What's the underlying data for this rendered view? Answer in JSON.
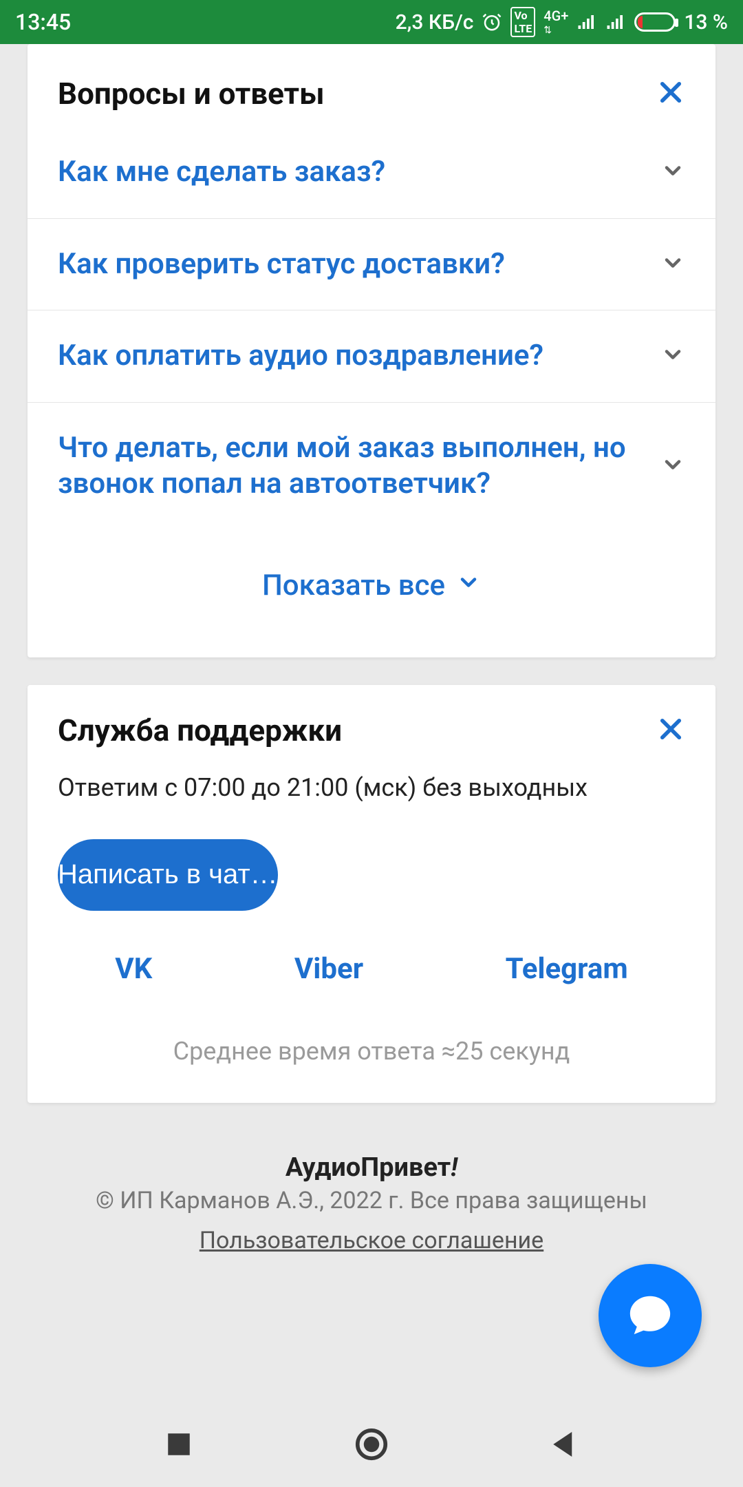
{
  "status": {
    "time": "13:45",
    "net_speed": "2,3 КБ/с",
    "volte": "VoLTE",
    "net_type": "4G+",
    "battery_text": "13 %"
  },
  "faq": {
    "title": "Вопросы и ответы",
    "items": [
      "Как мне сделать заказ?",
      "Как проверить статус доставки?",
      "Как оплатить аудио поздравление?",
      "Что делать, если мой заказ выполнен, но звонок попал на автоответчик?"
    ],
    "show_all": "Показать все"
  },
  "support": {
    "title": "Служба поддержки",
    "subtitle": "Ответим с 07:00 до 21:00 (мск) без выходных",
    "chat_button": "Написать в чат…",
    "links": {
      "vk": "VK",
      "viber": "Viber",
      "telegram": "Telegram"
    },
    "avg": "Среднее время ответа ≈25 секунд"
  },
  "footer": {
    "brand_a": "АудиоПривет",
    "brand_b": "!",
    "copy": "© ИП Карманов А.Э., 2022 г. Все права защищены",
    "terms": "Пользовательское соглашение"
  }
}
